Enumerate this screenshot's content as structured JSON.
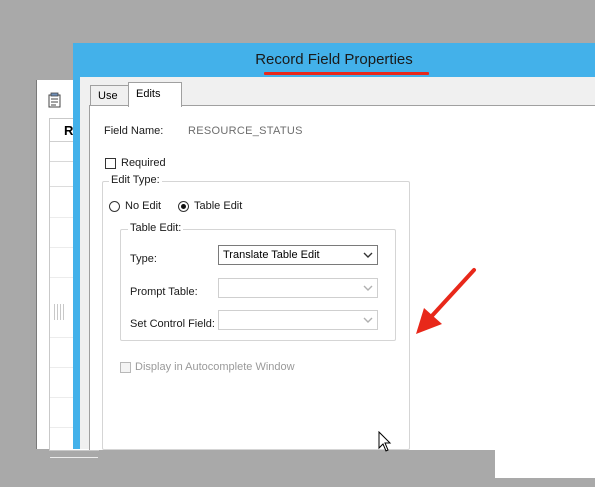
{
  "background_window": {
    "header_label": "R"
  },
  "dialog": {
    "title": "Record Field Properties",
    "tabs": [
      {
        "label": "Use",
        "active": false
      },
      {
        "label": "Edits",
        "active": true
      }
    ],
    "field_name_label": "Field Name:",
    "field_name_value": "RESOURCE_STATUS",
    "required": {
      "label": "Required",
      "checked": false
    },
    "edit_type": {
      "legend": "Edit Type:",
      "options": [
        {
          "label": "No Edit",
          "selected": false
        },
        {
          "label": "Table Edit",
          "selected": true
        }
      ]
    },
    "table_edit": {
      "legend": "Table Edit:",
      "type_label": "Type:",
      "type_value": "Translate Table Edit",
      "prompt_table_label": "Prompt Table:",
      "prompt_table_value": "",
      "set_control_label": "Set Control Field:",
      "set_control_value": ""
    },
    "autocomplete": {
      "label": "Display in Autocomplete Window",
      "checked": false,
      "enabled": false
    }
  },
  "colors": {
    "title_bar": "#43b1ea",
    "annotation": "#e8281a"
  }
}
